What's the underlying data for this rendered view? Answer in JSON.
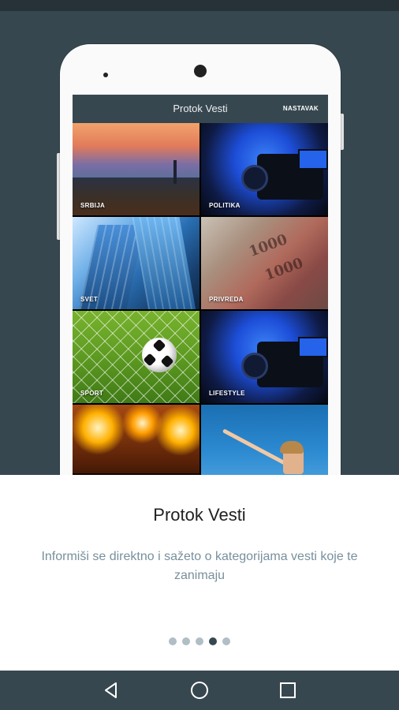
{
  "phone_app": {
    "appbar_title": "Protok Vesti",
    "appbar_action": "NASTAVAK",
    "categories": [
      {
        "label": "SRBIJA"
      },
      {
        "label": "POLITIKA"
      },
      {
        "label": "SVET"
      },
      {
        "label": "PRIVREDA"
      },
      {
        "label": "SPORT"
      },
      {
        "label": "LIFESTYLE"
      },
      {
        "label": ""
      },
      {
        "label": ""
      }
    ],
    "banknote_text": "1000"
  },
  "onboarding": {
    "title": "Protok Vesti",
    "description": "Informiši se direktno i sažeto o kategorijama vesti koje te zanimaju",
    "page_count": 5,
    "active_page": 4
  },
  "navbar": {
    "icons": [
      "back-icon",
      "home-icon",
      "recents-icon"
    ]
  },
  "colors": {
    "background": "#37474f",
    "appbar": "#37474f",
    "dot_active": "#37474f",
    "dot_inactive": "#b0bec5",
    "description_text": "#78909c"
  }
}
